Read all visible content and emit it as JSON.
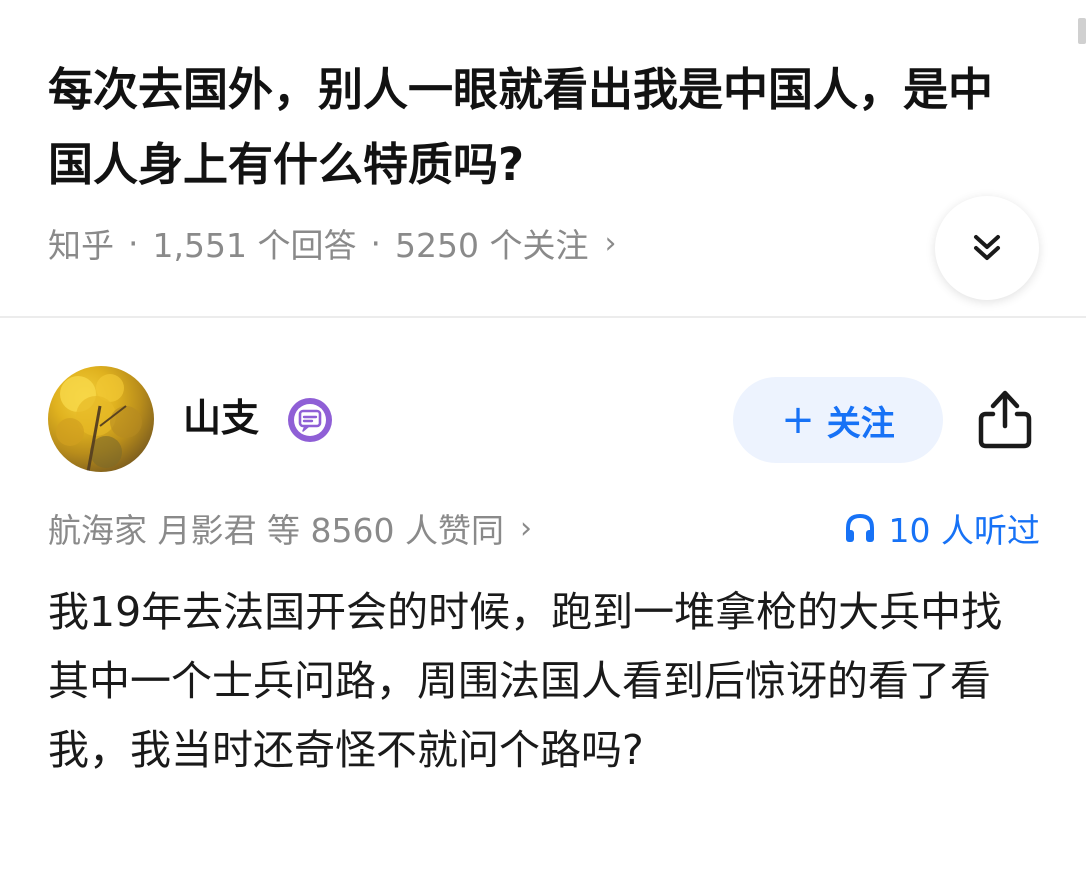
{
  "question": {
    "title": "每次去国外，别人一眼就看出我是中国人，是中国人身上有什么特质吗?",
    "source": "知乎",
    "separator": "·",
    "answers_count": "1,551 个回答",
    "followers_count": "5250 个关注",
    "chevron": "›"
  },
  "author": {
    "name": "山支",
    "avatar_icon": "avatar-ginkgo-tree",
    "badge_icon": "message-badge-icon",
    "follow_label": "关注",
    "follow_plus": "+"
  },
  "answer": {
    "upvote_text": "航海家 月影君 等 8560 人赞同",
    "upvote_chevron": "›",
    "listen_text": "10 人听过",
    "body": "我19年去法国开会的时候，跑到一堆拿枪的大兵中找其中一个士兵问路，周围法国人看到后惊讶的看了看我，我当时还奇怪不就问个路吗?"
  },
  "colors": {
    "accent": "#1772f6",
    "follow_bg": "#edf3fe",
    "meta_text": "#8a8a8a",
    "badge": "#8f5fd6"
  }
}
